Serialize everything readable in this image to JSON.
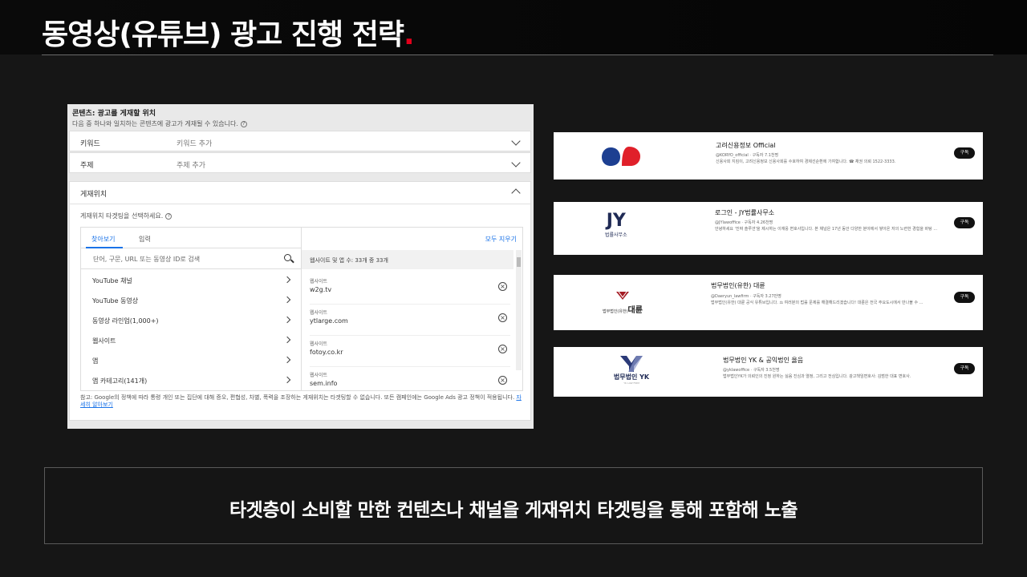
{
  "slide": {
    "title": "동영상(유튜브) 광고 진행 전략",
    "title_dot": ".",
    "accent_color": "#e3001b",
    "caption": "타겟층이 소비할 만한 컨텐츠나 채널을 게재위치 타겟팅을 통해 포함해 노출"
  },
  "panel": {
    "header_title": "콘텐츠: 광고를 게재할 위치",
    "header_sub": "다음 중 하나와 일치하는 콘텐츠에 광고가 게재될 수 있습니다.",
    "keyword_label": "키워드",
    "keyword_value": "키워드 추가",
    "topic_label": "주제",
    "topic_value": "주제 추가",
    "placement_label": "게재위치",
    "placement_sub": "게재위치 타겟팅을 선택하세요.",
    "tab_browse": "찾아보기",
    "tab_enter": "입력",
    "clear_all": "모두 지우기",
    "search_placeholder": "단어, 구문, URL 또는 동영상 ID로 검색",
    "list_items": [
      "YouTube 채널",
      "YouTube 동영상",
      "동영상 라인업(1,000+)",
      "웹사이트",
      "앱",
      "앱 카테고리(141개)"
    ],
    "selected_header": "웹사이트 및 앱 수: 33개 중 33개",
    "selected_items": [
      {
        "kind": "웹사이트",
        "value": "w2g.tv"
      },
      {
        "kind": "웹사이트",
        "value": "ytlarge.com"
      },
      {
        "kind": "웹사이트",
        "value": "fotoy.co.kr"
      },
      {
        "kind": "웹사이트",
        "value": "sem.info"
      }
    ],
    "note": "참고: Google의 정책에 따라 통령 개인 또는 집단에 대해 증오, 편협성, 차별, 폭력을 조장하는 게재위치는 타겟팅할 수 없습니다. 또든 캠페인에는 Google Ads 광고 정책이 적용됩니다.",
    "note_link": "자세히 알아보기"
  },
  "cards": [
    {
      "name": "고려신용정보 Official",
      "meta": "@KORYO_official · 구독자 7.1천명",
      "desc": "신용사회 지킴이, 고려신용정보 신용사회를 수호하여 경제선순환에 기여합니다. ☎ 채권 의뢰 1522-3333.",
      "subscribe": "구독"
    },
    {
      "name": "로그인 - JY법률사무소",
      "meta": "@JYlawoffice · 구독자 4.26천명",
      "desc": "안녕하세요 '진짜 솔루션'을 제시하는 이재웅 변호사입니다. 본 채널은 17년 동안 다양한 분야에서 쌓아온 저의 노련한 경험을 바탕 ...",
      "subscribe": "구독",
      "logo_text": "JY",
      "logo_sub": "법률사무소"
    },
    {
      "name": "법무법인(유한) 대륜",
      "meta": "@Daeryun_lawfirm · 구독자 3.27만명",
      "desc": "법무법인(유한) 대륜 공식 유튜브입니다. ⚖ 여러분의 법률 문제를 해결해드리겠습니다! 대륜은 전국 주요도시에서 만나볼 수 ...",
      "subscribe": "구독",
      "logo_text": "대륜",
      "logo_sub": "법무법인(유한)"
    },
    {
      "name": "법무법인 YK & 공익법인 옳음",
      "meta": "@yklawoffice · 구독자 3.5천명",
      "desc": "법무법인YK가 의뢰인의 진정 원하는 싫음 진심과 열정, 그리고 전심입니다. 광고책임변호사: 김범한 대표 변호사.",
      "subscribe": "구독",
      "logo_text": "법무법인 YK",
      "logo_sub": "YK LAW FIRM"
    }
  ]
}
